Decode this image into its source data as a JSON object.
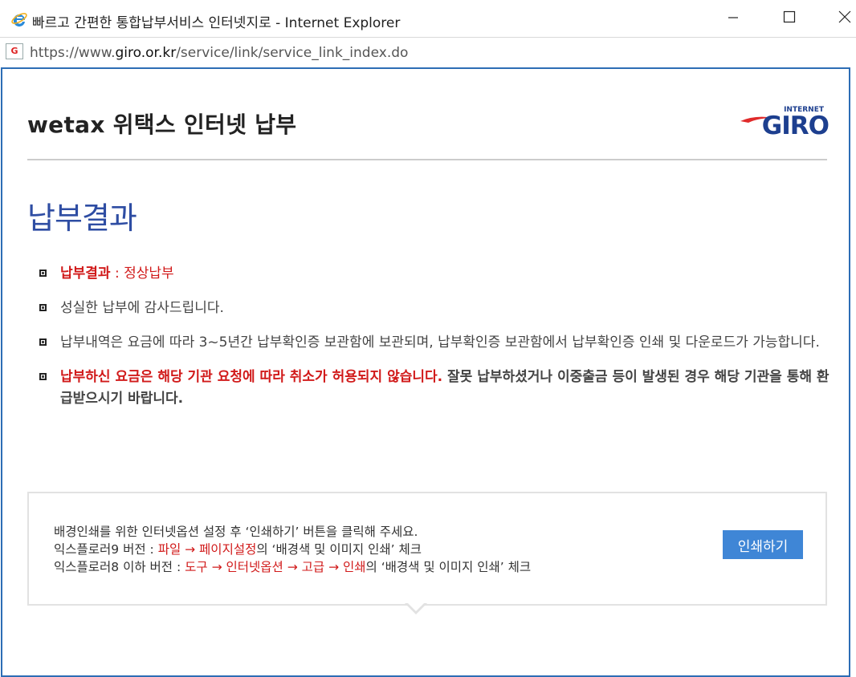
{
  "window": {
    "title": "빠르고 간편한 통합납부서비스 인터넷지로 - Internet Explorer"
  },
  "address": {
    "url_prefix": "https://www.",
    "url_host": "giro.or.kr",
    "url_path": "/service/link/service_link_index.do"
  },
  "header": {
    "title": "wetax 위택스 인터넷 납부",
    "logo": {
      "small_text": "INTERNET",
      "main_text": "GIRO"
    }
  },
  "page": {
    "title": "납부결과"
  },
  "bullets": [
    {
      "label": "납부결과",
      "separator": " : ",
      "value": "정상납부"
    },
    {
      "text": "성실한 납부에 감사드립니다."
    },
    {
      "text": "납부내역은 요금에 따라 3~5년간 납부확인증 보관함에 보관되며, 납부확인증 보관함에서 납부확인증 인쇄 및 다운로드가 가능합니다."
    },
    {
      "red_text": "납부하신 요금은 해당 기관 요청에 따라 취소가 허용되지 않습니다.",
      "text": " 잘못 납부하셨거나 이중출금 등이 발생된 경우 해당 기관을 통해 환급받으시기 바랍니다."
    }
  ],
  "notice": {
    "line1": "배경인쇄를 위한 인터넷옵션 설정 후 ‘인쇄하기’ 버튼을 클릭해 주세요.",
    "line2_prefix": "익스플로러9 버전 : ",
    "line2_path": "파일 → 페이지설정",
    "line2_suffix": "의 ‘배경색 및 이미지 인쇄’ 체크",
    "line3_prefix": "익스플로러8 이하 버전 : ",
    "line3_path": "도구 → 인터넷옵션 → 고급 → 인쇄",
    "line3_suffix": "의 ‘배경색 및 이미지 인쇄’ 체크",
    "print_button": "인쇄하기"
  },
  "colors": {
    "accent_blue": "#2e4da3",
    "frame_blue": "#2d6db5",
    "button_blue": "#3f86d6",
    "alert_red": "#d11a1a"
  }
}
